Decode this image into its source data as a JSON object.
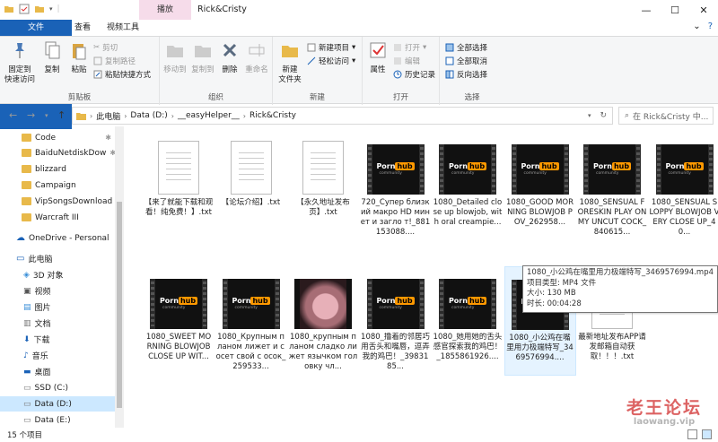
{
  "window": {
    "title": "Rick&Cristy",
    "context_tab": "播放"
  },
  "ribbon_tabs": [
    "文件",
    "主页",
    "共享",
    "查看",
    "视频工具"
  ],
  "ribbon": {
    "clipboard": {
      "label": "剪贴板",
      "pin": "固定到\n快速访问",
      "copy": "复制",
      "paste": "粘贴",
      "cut": "剪切",
      "copy_path": "复制路径",
      "paste_shortcut": "粘贴快捷方式"
    },
    "organize": {
      "label": "组织",
      "move_to": "移动到",
      "copy_to": "复制到",
      "delete": "删除",
      "rename": "重命名"
    },
    "new": {
      "label": "新建",
      "new_folder": "新建\n文件夹",
      "new_item": "新建项目",
      "easy_access": "轻松访问"
    },
    "open": {
      "label": "打开",
      "properties": "属性",
      "open": "打开",
      "edit": "编辑",
      "history": "历史记录"
    },
    "select": {
      "label": "选择",
      "select_all": "全部选择",
      "select_none": "全部取消",
      "invert": "反向选择"
    }
  },
  "address": {
    "crumbs": [
      "此电脑",
      "Data (D:)",
      "__easyHelper__",
      "Rick&Cristy"
    ],
    "search_placeholder": "在 Rick&Cristy 中..."
  },
  "nav": {
    "quick": [
      "Code",
      "BaiduNetdiskDow",
      "blizzard",
      "Campaign",
      "VipSongsDownload",
      "Warcraft III"
    ],
    "onedrive": "OneDrive - Personal",
    "this_pc": "此电脑",
    "pc_items": [
      "3D 对象",
      "视频",
      "图片",
      "文档",
      "下载",
      "音乐",
      "桌面",
      "SSD (C:)",
      "Data (D:)",
      "Data (E:)"
    ]
  },
  "files": [
    {
      "type": "doc",
      "name": "【来了就能下载和观看！纯免费！】.txt"
    },
    {
      "type": "doc",
      "name": "【论坛介绍】.txt"
    },
    {
      "type": "doc",
      "name": "【永久地址发布页】.txt"
    },
    {
      "type": "video",
      "name": "720_Супер близкий макро HD минет и загло т!_881153088...."
    },
    {
      "type": "video",
      "name": "1080_Detailed close up blowjob, with oral creampie..."
    },
    {
      "type": "video",
      "name": "1080_GOOD MORNING BLOWJOB POV_262958..."
    },
    {
      "type": "video",
      "name": "1080_SENSUAL FORESKIN PLAY ON MY UNCUT COCK_840615..."
    },
    {
      "type": "video",
      "name": "1080_SENSUAL SLOPPY BLOWJOB VERY CLOSE UP_40..."
    },
    {
      "type": "video",
      "name": "1080_SWEET MORNING BLOWJOB CLOSE UP WIT..."
    },
    {
      "type": "video",
      "name": "1080_Крупным планом лижет и сосет свой с осок_259533..."
    },
    {
      "type": "photo",
      "name": "1080_крупным планом сладко лижет язычком головку чл..."
    },
    {
      "type": "video",
      "name": "1080_撸着的邻居巧用舌头和嘴唇，逗弄我的鸡巴！_3983185..."
    },
    {
      "type": "video",
      "name": "1080_她用她的舌头感官探索我的鸡巴！_1855861926...."
    },
    {
      "type": "video",
      "name": "1080_小公鸡在嘴里用力极端特写_3469576994...."
    },
    {
      "type": "doc",
      "name": "最新地址发布APP请发邮箱自动获取！！！.txt"
    }
  ],
  "tooltip": {
    "title": "1080_小公鸡在嘴里用力极端特写_3469576994.mp4",
    "type": "项目类型: MP4 文件",
    "size": "大小: 130 MB",
    "duration": "时长: 00:04:28"
  },
  "status": {
    "count": "15 个项目"
  },
  "watermark": {
    "line1": "老王论坛",
    "line2": "laowang.vip"
  }
}
